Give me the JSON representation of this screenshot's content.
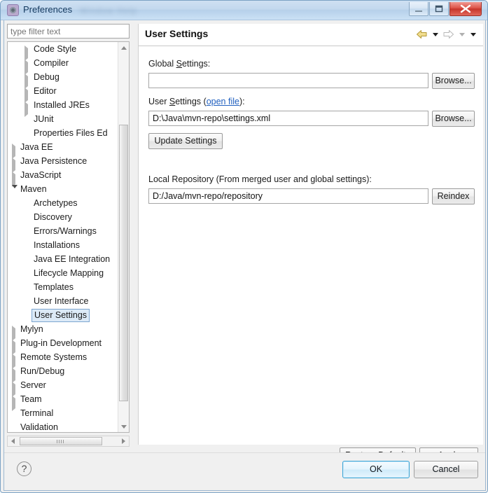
{
  "window": {
    "title": "Preferences",
    "blurred_title_suffix": "Window  Help",
    "controls": {
      "minimize": "minimize-icon",
      "maximize": "maximize-icon",
      "close": "close-icon"
    }
  },
  "filter": {
    "placeholder": "type filter text",
    "value": ""
  },
  "tree": {
    "items": [
      {
        "label": "Code Style",
        "level": 1,
        "state": "collapsed",
        "selected": false
      },
      {
        "label": "Compiler",
        "level": 1,
        "state": "collapsed",
        "selected": false
      },
      {
        "label": "Debug",
        "level": 1,
        "state": "collapsed",
        "selected": false
      },
      {
        "label": "Editor",
        "level": 1,
        "state": "collapsed",
        "selected": false
      },
      {
        "label": "Installed JREs",
        "level": 1,
        "state": "collapsed",
        "selected": false
      },
      {
        "label": "JUnit",
        "level": 1,
        "state": "leaf",
        "selected": false
      },
      {
        "label": "Properties Files Ed",
        "level": 1,
        "state": "leaf",
        "selected": false
      },
      {
        "label": "Java EE",
        "level": 0,
        "state": "collapsed",
        "selected": false
      },
      {
        "label": "Java Persistence",
        "level": 0,
        "state": "collapsed",
        "selected": false
      },
      {
        "label": "JavaScript",
        "level": 0,
        "state": "collapsed",
        "selected": false
      },
      {
        "label": "Maven",
        "level": 0,
        "state": "expanded",
        "selected": false
      },
      {
        "label": "Archetypes",
        "level": 1,
        "state": "leaf",
        "selected": false
      },
      {
        "label": "Discovery",
        "level": 1,
        "state": "leaf",
        "selected": false
      },
      {
        "label": "Errors/Warnings",
        "level": 1,
        "state": "leaf",
        "selected": false
      },
      {
        "label": "Installations",
        "level": 1,
        "state": "leaf",
        "selected": false
      },
      {
        "label": "Java EE Integration",
        "level": 1,
        "state": "leaf",
        "selected": false
      },
      {
        "label": "Lifecycle Mapping",
        "level": 1,
        "state": "leaf",
        "selected": false
      },
      {
        "label": "Templates",
        "level": 1,
        "state": "leaf",
        "selected": false
      },
      {
        "label": "User Interface",
        "level": 1,
        "state": "leaf",
        "selected": false
      },
      {
        "label": "User Settings",
        "level": 1,
        "state": "leaf",
        "selected": true
      },
      {
        "label": "Mylyn",
        "level": 0,
        "state": "collapsed",
        "selected": false
      },
      {
        "label": "Plug-in Development",
        "level": 0,
        "state": "collapsed",
        "selected": false
      },
      {
        "label": "Remote Systems",
        "level": 0,
        "state": "collapsed",
        "selected": false
      },
      {
        "label": "Run/Debug",
        "level": 0,
        "state": "collapsed",
        "selected": false
      },
      {
        "label": "Server",
        "level": 0,
        "state": "collapsed",
        "selected": false
      },
      {
        "label": "Team",
        "level": 0,
        "state": "collapsed",
        "selected": false
      },
      {
        "label": "Terminal",
        "level": 0,
        "state": "leaf",
        "selected": false
      },
      {
        "label": "Validation",
        "level": 0,
        "state": "leaf",
        "selected": false
      }
    ]
  },
  "page": {
    "title": "User Settings",
    "nav": {
      "back": "back-arrow-icon",
      "back_menu": "chevron-down-icon",
      "forward": "forward-arrow-icon",
      "forward_menu": "chevron-down-icon",
      "view_menu": "chevron-down-icon"
    },
    "global_settings": {
      "label_pre": "Global ",
      "label_mnemonic": "S",
      "label_post": "ettings:",
      "value": "",
      "browse_label": "Browse..."
    },
    "user_settings": {
      "label_pre": "User ",
      "label_mnemonic": "S",
      "label_mid": "ettings (",
      "link": "open file",
      "label_post": "):",
      "value": "D:\\Java\\mvn-repo\\settings.xml",
      "browse_label": "Browse...",
      "update_label": "Update Settings"
    },
    "local_repository": {
      "label": "Local Repository (From merged user and global settings):",
      "value": "D:/Java/mvn-repo/repository",
      "reindex_label": "Reindex"
    },
    "restore_defaults_label": "Restore Defaults",
    "apply_label": "Apply"
  },
  "footer": {
    "help": "?",
    "ok_label": "OK",
    "cancel_label": "Cancel"
  },
  "colors": {
    "titlebar_accent": "#b6d0ea",
    "close_button": "#c6352c",
    "selection": "#dceaf7",
    "selection_border": "#7ea6d0",
    "link": "#1f5fbf",
    "default_button_border": "#3ba6d8",
    "back_arrow": "#e8cf72"
  }
}
